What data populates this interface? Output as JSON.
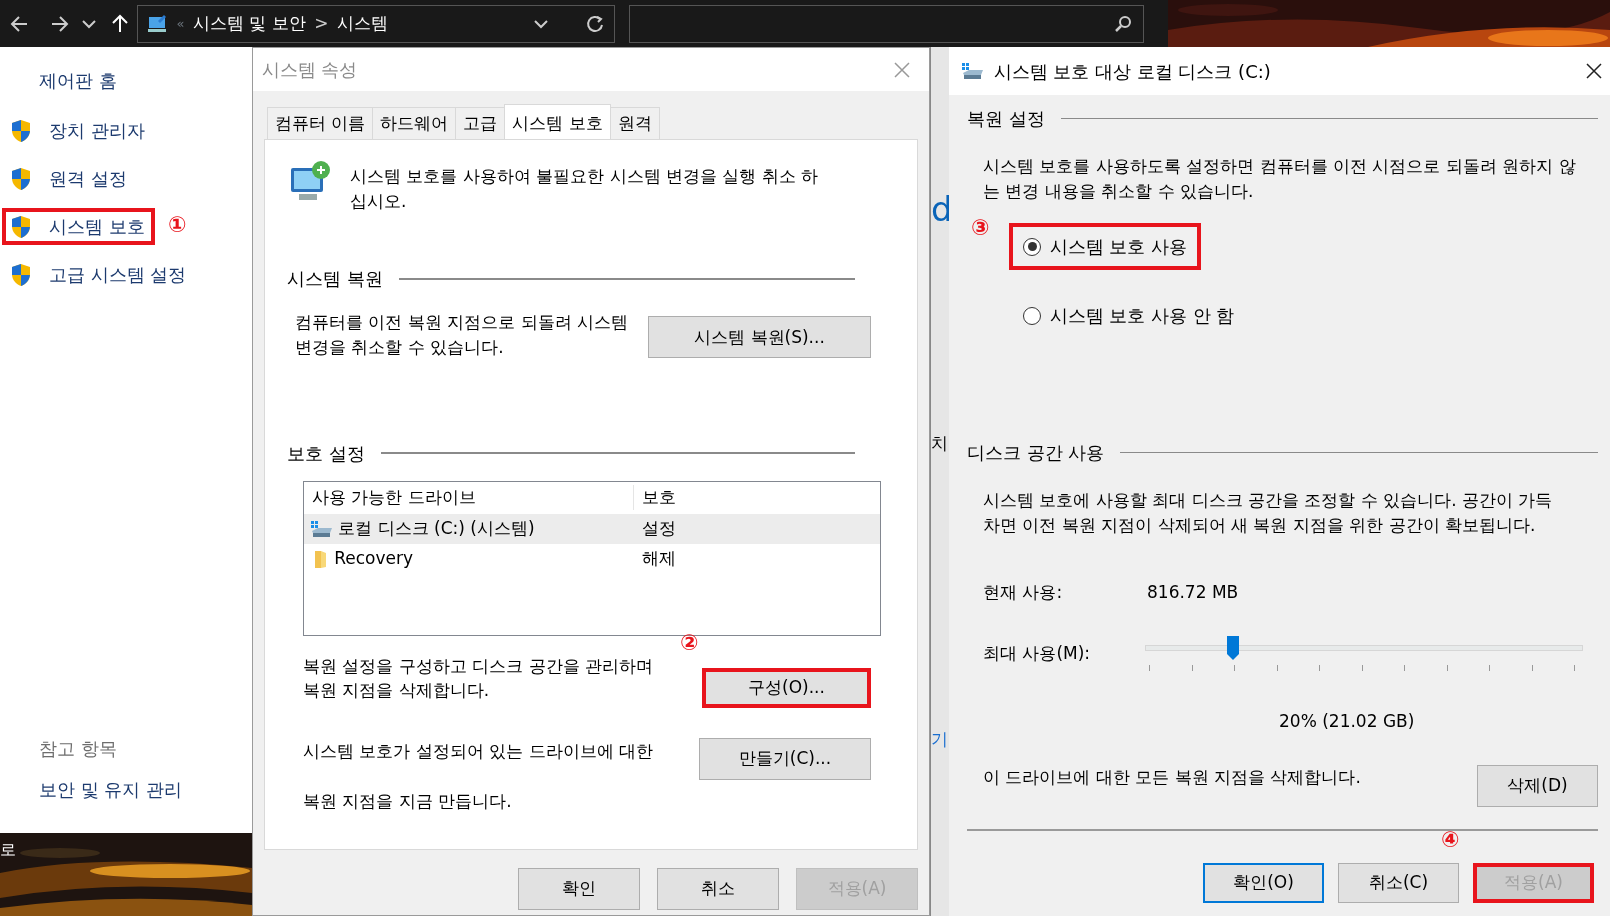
{
  "explorer_bar": {
    "overflow": "«",
    "path": [
      "시스템 및 보안",
      "시스템"
    ],
    "separator": ">"
  },
  "sidebar": {
    "home": "제어판 홈",
    "items": [
      {
        "label": "장치 관리자",
        "highlighted": false
      },
      {
        "label": "원격 설정",
        "highlighted": false
      },
      {
        "label": "시스템 보호",
        "highlighted": true,
        "callout": "①"
      },
      {
        "label": "고급 시스템 설정",
        "highlighted": false
      }
    ],
    "see_also": {
      "heading": "참고 항목",
      "links": [
        "보안 및 유지 관리"
      ]
    }
  },
  "background_window": {
    "texts": [
      {
        "text": "d",
        "kind": "heading"
      },
      {
        "text": "치",
        "kind": "plain"
      },
      {
        "text": "기",
        "kind": "link"
      }
    ]
  },
  "desktop": {
    "text": "로"
  },
  "system_properties": {
    "title": "시스템 속성",
    "tabs": [
      {
        "label": "컴퓨터 이름",
        "selected": false
      },
      {
        "label": "하드웨어",
        "selected": false
      },
      {
        "label": "고급",
        "selected": false
      },
      {
        "label": "시스템 보호",
        "selected": true
      },
      {
        "label": "원격",
        "selected": false
      }
    ],
    "intro": "시스템 보호를 사용하여 불필요한 시스템 변경을 실행 취소 하십시오.",
    "restore_group": {
      "title": "시스템 복원",
      "text": "컴퓨터를 이전 복원 지점으로 되돌려 시스템 변경을 취소할 수 있습니다.",
      "button": "시스템 복원(S)..."
    },
    "protection_group": {
      "title": "보호 설정",
      "columns": [
        "사용 가능한 드라이브",
        "보호"
      ],
      "rows": [
        {
          "kind": "drive",
          "name": "로컬 디스크 (C:) (시스템)",
          "protection": "설정",
          "selected": true
        },
        {
          "kind": "folder",
          "name": "Recovery",
          "protection": "해제",
          "selected": false
        }
      ],
      "configure": {
        "text": "복원 설정을 구성하고 디스크 공간을 관리하며 복원 지점을 삭제합니다.",
        "button": {
          "label": "구성(O)...",
          "highlighted": true,
          "callout": "②"
        }
      },
      "create": {
        "lines": [
          "시스템 보호가 설정되어 있는 드라이브에 대한",
          "복원 지점을 지금 만듭니다."
        ],
        "button": "만들기(C)..."
      }
    },
    "buttons": [
      {
        "label": "확인",
        "disabled": false
      },
      {
        "label": "취소",
        "disabled": false
      },
      {
        "label": "적용(A)",
        "disabled": true
      }
    ]
  },
  "restore_dialog": {
    "title": "시스템 보호 대상 로컬 디스크 (C:)",
    "restore_settings": {
      "title": "복원 설정",
      "text": "시스템 보호를 사용하도록 설정하면 컴퓨터를 이전 시점으로 되돌려 원하지 않는 변경 내용을 취소할 수 있습니다.",
      "options": [
        {
          "label": "시스템 보호 사용",
          "selected": true,
          "highlighted": true,
          "callout": "③"
        },
        {
          "label": "시스템 보호 사용 안 함",
          "selected": false,
          "highlighted": false
        }
      ]
    },
    "disk_usage": {
      "title": "디스크 공간 사용",
      "text": "시스템 보호에 사용할 최대 디스크 공간을 조정할 수 있습니다. 공간이 가득 차면 이전 복원 지점이 삭제되어 새 복원 지점을 위한 공간이 확보됩니다.",
      "current_label": "현재 사용:",
      "current_value": "816.72 MB",
      "max_label": "최대 사용(M):",
      "slider": {
        "level": 0.2
      },
      "reading": "20% (21.02 GB)",
      "delete_text": "이 드라이브에 대한 모든 복원 지점을 삭제합니다.",
      "delete_button": "삭제(D)"
    },
    "buttons": [
      {
        "label": "확인(O)",
        "default": true,
        "disabled": false,
        "highlighted": false
      },
      {
        "label": "취소(C)",
        "default": false,
        "disabled": false,
        "highlighted": false
      },
      {
        "label": "적용(A)",
        "default": false,
        "disabled": true,
        "highlighted": true,
        "callout": "④"
      }
    ]
  }
}
